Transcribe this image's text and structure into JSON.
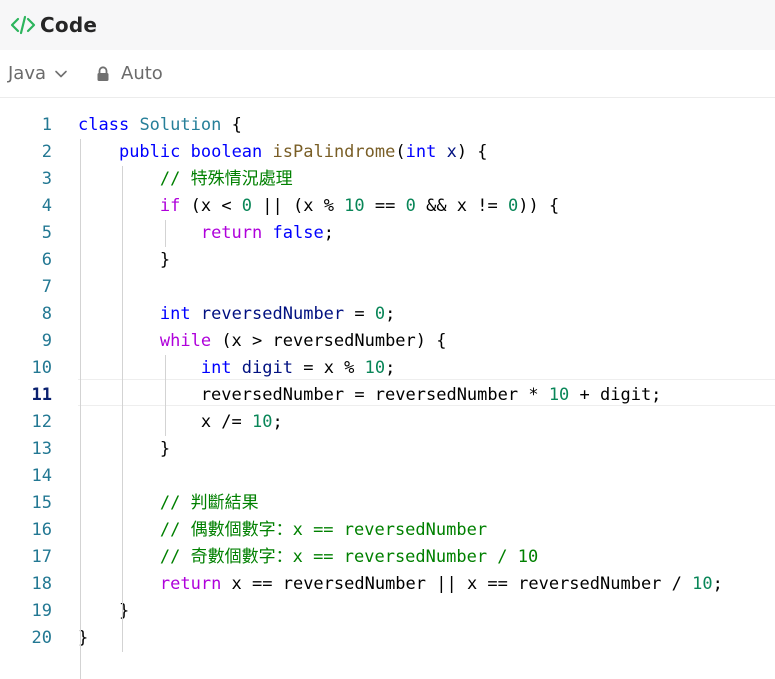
{
  "header": {
    "title": "Code",
    "icon": "code-brackets-icon",
    "accent": "#2db55d"
  },
  "toolbar": {
    "language": "Java",
    "mode_label": "Auto"
  },
  "editor": {
    "active_line": 11,
    "lines": [
      {
        "n": "1",
        "tokens": [
          {
            "t": "class",
            "c": "kw"
          },
          {
            "t": " ",
            "c": "pl"
          },
          {
            "t": "Solution",
            "c": "ty"
          },
          {
            "t": " {",
            "c": "pl"
          }
        ]
      },
      {
        "n": "2",
        "tokens": [
          {
            "t": "    ",
            "c": "pl"
          },
          {
            "t": "public",
            "c": "kw"
          },
          {
            "t": " ",
            "c": "pl"
          },
          {
            "t": "boolean",
            "c": "kw"
          },
          {
            "t": " ",
            "c": "pl"
          },
          {
            "t": "isPalindrome",
            "c": "fn"
          },
          {
            "t": "(",
            "c": "pl"
          },
          {
            "t": "int",
            "c": "kw"
          },
          {
            "t": " ",
            "c": "pl"
          },
          {
            "t": "x",
            "c": "var"
          },
          {
            "t": ") {",
            "c": "pl"
          }
        ]
      },
      {
        "n": "3",
        "tokens": [
          {
            "t": "        ",
            "c": "pl"
          },
          {
            "t": "// 特殊情況處理",
            "c": "cm"
          }
        ]
      },
      {
        "n": "4",
        "tokens": [
          {
            "t": "        ",
            "c": "pl"
          },
          {
            "t": "if",
            "c": "ctl"
          },
          {
            "t": " (x < ",
            "c": "pl"
          },
          {
            "t": "0",
            "c": "num"
          },
          {
            "t": " || (x % ",
            "c": "pl"
          },
          {
            "t": "10",
            "c": "num"
          },
          {
            "t": " == ",
            "c": "pl"
          },
          {
            "t": "0",
            "c": "num"
          },
          {
            "t": " && x != ",
            "c": "pl"
          },
          {
            "t": "0",
            "c": "num"
          },
          {
            "t": ")) {",
            "c": "pl"
          }
        ]
      },
      {
        "n": "5",
        "tokens": [
          {
            "t": "            ",
            "c": "pl"
          },
          {
            "t": "return",
            "c": "ctl"
          },
          {
            "t": " ",
            "c": "pl"
          },
          {
            "t": "false",
            "c": "kw"
          },
          {
            "t": ";",
            "c": "pl"
          }
        ]
      },
      {
        "n": "6",
        "tokens": [
          {
            "t": "        }",
            "c": "pl"
          }
        ]
      },
      {
        "n": "7",
        "tokens": []
      },
      {
        "n": "8",
        "tokens": [
          {
            "t": "        ",
            "c": "pl"
          },
          {
            "t": "int",
            "c": "kw"
          },
          {
            "t": " ",
            "c": "pl"
          },
          {
            "t": "reversedNumber",
            "c": "var"
          },
          {
            "t": " = ",
            "c": "pl"
          },
          {
            "t": "0",
            "c": "num"
          },
          {
            "t": ";",
            "c": "pl"
          }
        ]
      },
      {
        "n": "9",
        "tokens": [
          {
            "t": "        ",
            "c": "pl"
          },
          {
            "t": "while",
            "c": "ctl"
          },
          {
            "t": " (x > reversedNumber) {",
            "c": "pl"
          }
        ]
      },
      {
        "n": "10",
        "tokens": [
          {
            "t": "            ",
            "c": "pl"
          },
          {
            "t": "int",
            "c": "kw"
          },
          {
            "t": " ",
            "c": "pl"
          },
          {
            "t": "digit",
            "c": "var"
          },
          {
            "t": " = x % ",
            "c": "pl"
          },
          {
            "t": "10",
            "c": "num"
          },
          {
            "t": ";",
            "c": "pl"
          }
        ]
      },
      {
        "n": "11",
        "tokens": [
          {
            "t": "            reversedNumber = reversedNumber * ",
            "c": "pl"
          },
          {
            "t": "10",
            "c": "num"
          },
          {
            "t": " + digit;",
            "c": "pl"
          }
        ]
      },
      {
        "n": "12",
        "tokens": [
          {
            "t": "            x /= ",
            "c": "pl"
          },
          {
            "t": "10",
            "c": "num"
          },
          {
            "t": ";",
            "c": "pl"
          }
        ]
      },
      {
        "n": "13",
        "tokens": [
          {
            "t": "        }",
            "c": "pl"
          }
        ]
      },
      {
        "n": "14",
        "tokens": []
      },
      {
        "n": "15",
        "tokens": [
          {
            "t": "        ",
            "c": "pl"
          },
          {
            "t": "// 判斷結果",
            "c": "cm"
          }
        ]
      },
      {
        "n": "16",
        "tokens": [
          {
            "t": "        ",
            "c": "pl"
          },
          {
            "t": "// 偶數個數字：x == reversedNumber",
            "c": "cm"
          }
        ]
      },
      {
        "n": "17",
        "tokens": [
          {
            "t": "        ",
            "c": "pl"
          },
          {
            "t": "// 奇數個數字：x == reversedNumber / 10",
            "c": "cm"
          }
        ]
      },
      {
        "n": "18",
        "tokens": [
          {
            "t": "        ",
            "c": "pl"
          },
          {
            "t": "return",
            "c": "ctl"
          },
          {
            "t": " x == reversedNumber || x == reversedNumber / ",
            "c": "pl"
          },
          {
            "t": "10",
            "c": "num"
          },
          {
            "t": ";",
            "c": "pl"
          }
        ]
      },
      {
        "n": "19",
        "tokens": [
          {
            "t": "    }",
            "c": "pl"
          }
        ]
      },
      {
        "n": "20",
        "tokens": [
          {
            "t": "}",
            "c": "pl"
          }
        ]
      }
    ]
  }
}
